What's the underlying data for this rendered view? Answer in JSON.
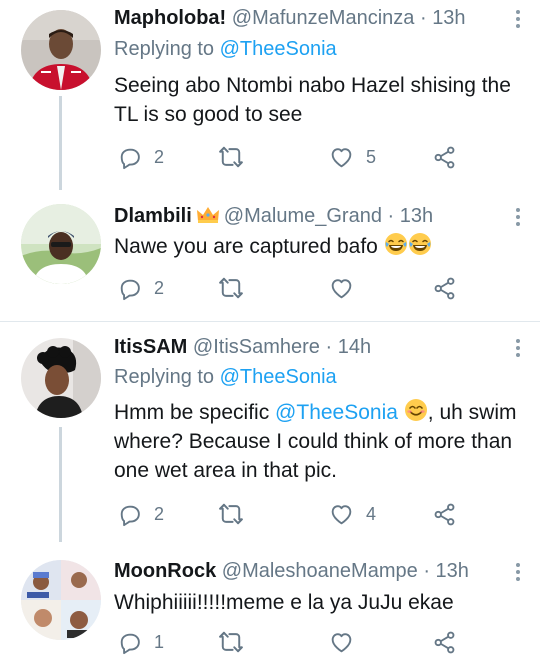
{
  "tweets": [
    {
      "name": "Mapholoba!",
      "handle": "@MafunzeMancinza",
      "time": "13h",
      "replying_label": "Replying to",
      "replying_to": "@TheeSonia",
      "text": "Seeing abo Ntombi nabo Hazel shising the TL is so good to see",
      "replies": "2",
      "retweets": "",
      "likes": "5"
    },
    {
      "name": "Dlambili",
      "handle": "@Malume_Grand",
      "time": "13h",
      "text": "Nawe you are captured bafo",
      "replies": "2",
      "retweets": "",
      "likes": ""
    },
    {
      "name": "ItisSAM",
      "handle": "@ItisSamhere",
      "time": "14h",
      "replying_label": "Replying to",
      "replying_to": "@TheeSonia",
      "text_before": "Hmm be specific ",
      "mention": "@TheeSonia",
      "text_after": ", uh swim where? Because I could think of more than one wet area in that pic.",
      "replies": "2",
      "retweets": "",
      "likes": "4"
    },
    {
      "name": "MoonRock",
      "handle": "@MaleshoaneMampe",
      "time": "13h",
      "text": "Whiphiiiii!!!!!meme e la ya JuJu ekae",
      "replies": "1",
      "retweets": "",
      "likes": ""
    }
  ],
  "separator": "·",
  "colors": {
    "accent": "#1da1f2",
    "muted": "#657786",
    "text": "#14171a",
    "divider": "#e1e8ed"
  },
  "icons": [
    "reply-icon",
    "retweet-icon",
    "like-icon",
    "share-icon",
    "more-icon",
    "crown-emoji",
    "laughing-emoji",
    "smiling-emoji"
  ]
}
